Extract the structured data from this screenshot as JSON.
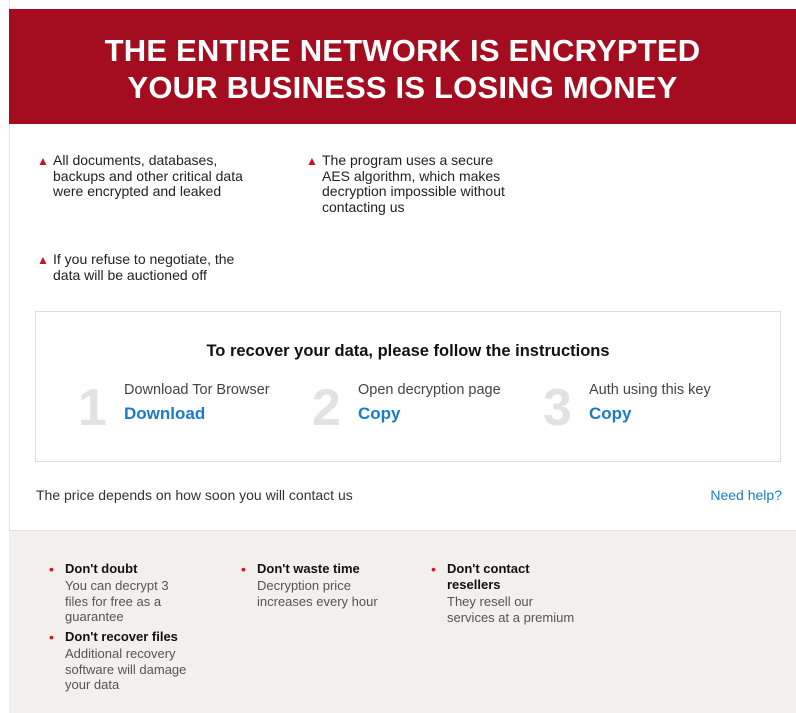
{
  "header": {
    "line1": "THE ENTIRE NETWORK IS ENCRYPTED",
    "line2": "YOUR BUSINESS IS LOSING MONEY",
    "bg_color": "#a30d1f"
  },
  "warnings": [
    {
      "lines": [
        "All documents, databases,",
        "backups and other critical data",
        "were encrypted and leaked"
      ]
    },
    {
      "lines": [
        "The program uses a secure",
        "AES algorithm, which makes",
        "decryption impossible without",
        "contacting us"
      ]
    },
    {
      "lines": [
        "If you refuse to negotiate, the",
        "data will be auctioned off"
      ]
    }
  ],
  "instructions": {
    "title": "To recover your data, please follow the instructions",
    "steps": [
      {
        "number": "1",
        "label": "Download Tor Browser",
        "action": "Download"
      },
      {
        "number": "2",
        "label": "Open decryption page",
        "action": "Copy"
      },
      {
        "number": "3",
        "label": "Auth using this key",
        "action": "Copy"
      }
    ],
    "link_color": "#1a7cc4"
  },
  "price_text": "The price depends on how soon you will contact us",
  "help_link": "Need help?",
  "tips": [
    {
      "head": "Don't doubt",
      "body": [
        "You can decrypt 3",
        "files for free as a",
        "guarantee"
      ]
    },
    {
      "head": "Don't recover files",
      "body": [
        "Additional recovery",
        "software will damage",
        "your data"
      ]
    },
    {
      "head": "Don't waste time",
      "body": [
        "Decryption price",
        "increases every hour"
      ]
    },
    {
      "head": [
        "Don't contact",
        "resellers"
      ],
      "body": [
        "They resell our",
        "services at a premium"
      ]
    }
  ],
  "icons": {
    "warning": "warning-triangle-icon",
    "bullet": "red-dot-icon"
  }
}
